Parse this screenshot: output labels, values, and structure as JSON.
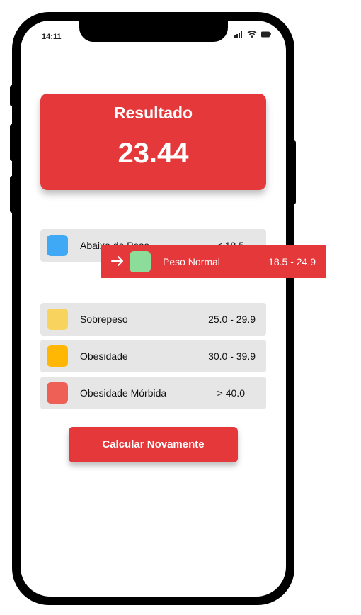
{
  "status_bar": {
    "time": "14:11"
  },
  "result": {
    "title": "Resultado",
    "value": "23.44"
  },
  "categories": [
    {
      "label": "Abaixo do Peso",
      "range": "< 18.5",
      "color": "#3fa9f5",
      "highlighted": false
    },
    {
      "label": "Peso Normal",
      "range": "18.5 - 24.9",
      "color": "#8cdc9a",
      "highlighted": true
    },
    {
      "label": "Sobrepeso",
      "range": "25.0 - 29.9",
      "color": "#f8d35e",
      "highlighted": false
    },
    {
      "label": "Obesidade",
      "range": "30.0 - 39.9",
      "color": "#ffb703",
      "highlighted": false
    },
    {
      "label": "Obesidade Mórbida",
      "range": "> 40.0",
      "color": "#ee6055",
      "highlighted": false
    }
  ],
  "actions": {
    "recalculate_label": "Calcular Novamente"
  },
  "colors": {
    "accent": "#e5383b",
    "row_background": "#e6e6e6"
  },
  "icons": {
    "highlight_marker": "arrow-right-icon",
    "signal": "cellular-signal-icon",
    "wifi": "wifi-icon",
    "battery": "battery-icon"
  }
}
